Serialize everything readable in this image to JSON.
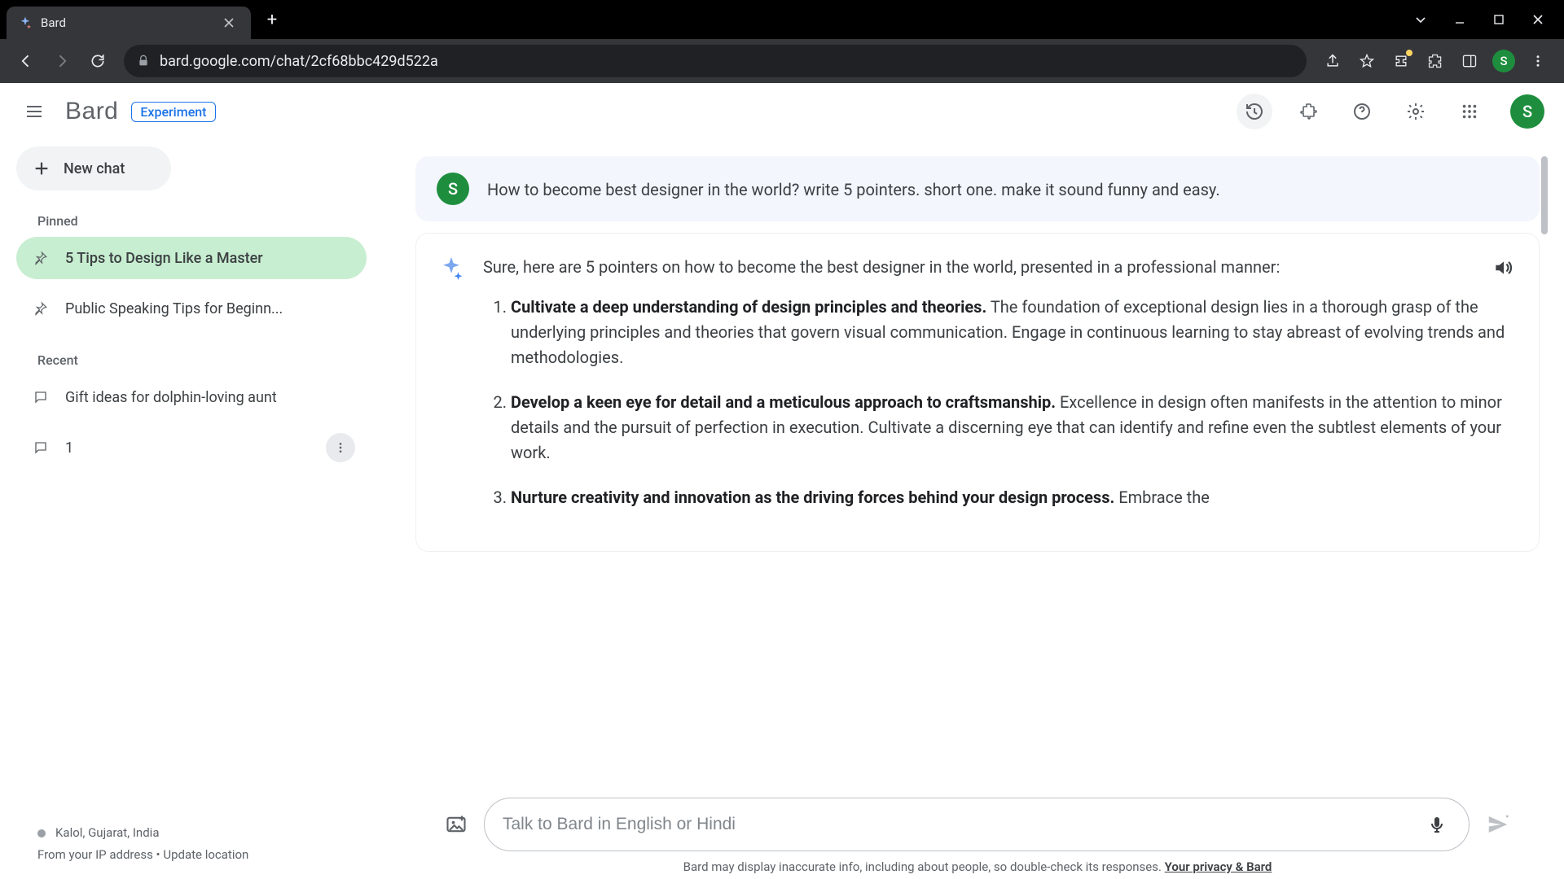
{
  "browser": {
    "tab_title": "Bard",
    "url": "bard.google.com/chat/2cf68bbc429d522a",
    "profile_initial": "S"
  },
  "header": {
    "brand": "Bard",
    "badge": "Experiment",
    "avatar_initial": "S"
  },
  "sidebar": {
    "new_chat_label": "New chat",
    "section_pinned": "Pinned",
    "section_recent": "Recent",
    "pinned": [
      {
        "label": "5 Tips to Design Like a Master"
      },
      {
        "label": "Public Speaking Tips for Beginn..."
      }
    ],
    "recent": [
      {
        "label": "Gift ideas for dolphin-loving aunt"
      },
      {
        "label": "1"
      }
    ],
    "location": "Kalol, Gujarat, India",
    "ip_label": "From your IP address",
    "update_location": "Update location"
  },
  "chat": {
    "user_initial": "S",
    "user_message": "How to become best designer in the world? write 5 pointers. short one. make it sound funny and easy.",
    "bot_intro": "Sure, here are 5 pointers on how to become the best designer in the world, presented in a professional manner:",
    "points": [
      {
        "bold": "Cultivate a deep understanding of design principles and theories.",
        "rest": " The foundation of exceptional design lies in a thorough grasp of the underlying principles and theories that govern visual communication. Engage in continuous learning to stay abreast of evolving trends and methodologies."
      },
      {
        "bold": "Develop a keen eye for detail and a meticulous approach to craftsmanship.",
        "rest": " Excellence in design often manifests in the attention to minor details and the pursuit of perfection in execution. Cultivate a discerning eye that can identify and refine even the subtlest elements of your work."
      },
      {
        "bold": "Nurture creativity and innovation as the driving forces behind your design process.",
        "rest": " Embrace the"
      }
    ]
  },
  "composer": {
    "placeholder": "Talk to Bard in English or Hindi"
  },
  "footer": {
    "disclaimer": "Bard may display inaccurate info, including about people, so double-check its responses. ",
    "privacy_link": "Your privacy & Bard"
  }
}
